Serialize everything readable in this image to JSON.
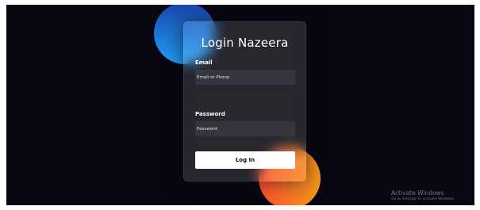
{
  "login": {
    "title": "Login Nazeera",
    "email_label": "Email",
    "email_placeholder": "Email or Phone",
    "password_label": "Password",
    "password_placeholder": "Password",
    "button_label": "Log In"
  },
  "watermark": {
    "title": "Activate Windows",
    "subtitle": "Go to Settings to activate Windows."
  },
  "colors": {
    "background": "#080710",
    "blue_shape_start": "#1845ad",
    "blue_shape_end": "#23a2f6",
    "orange_shape_start": "#ff512f",
    "orange_shape_end": "#f09819",
    "button_background": "#ffffff",
    "button_text": "#080710"
  }
}
